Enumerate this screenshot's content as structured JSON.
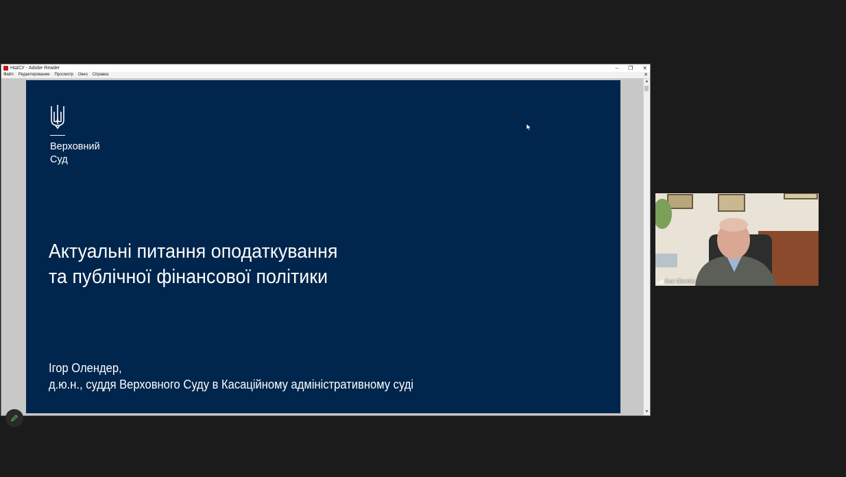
{
  "window": {
    "title": "НШСУ - Adobe Reader",
    "controls": {
      "minimize": "–",
      "maximize": "❐",
      "close": "✕"
    },
    "menu": [
      "Файл",
      "Редактирование",
      "Просмотр",
      "Окно",
      "Справка"
    ],
    "close_doc": "✕"
  },
  "slide": {
    "org_line1": "Верховний",
    "org_line2": "Суд",
    "title_line1": "Актуальні питання оподаткування",
    "title_line2": "та публічної фінансової політики",
    "presenter_line1": "Ігор Олендер,",
    "presenter_line2": "д.ю.н., суддя Верховного Суду в Касаційному адміністративному суді"
  },
  "participant": {
    "name": "Ihor Olender"
  },
  "colors": {
    "slide_bg": "#00264d",
    "meeting_bg": "#1b1b1b",
    "annotate_icon": "#4caf50"
  }
}
